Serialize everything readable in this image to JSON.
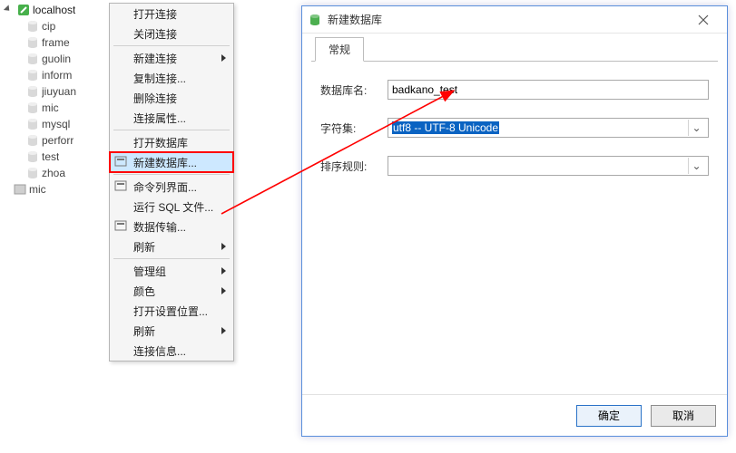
{
  "tree": {
    "root": "localhost",
    "children": [
      "cip",
      "frame",
      "guolin",
      "inform",
      "jiuyuan",
      "mic",
      "mysql",
      "perforr",
      "test",
      "zhoa"
    ],
    "other": "mic"
  },
  "contextmenu": {
    "header": "打开连接",
    "groups": [
      [
        "关闭连接"
      ],
      [
        "新建连接",
        "复制连接...",
        "删除连接",
        "连接属性..."
      ],
      [
        "打开数据库",
        "新建数据库..."
      ],
      [
        "命令列界面...",
        "运行 SQL 文件...",
        "数据传输...",
        "刷新"
      ],
      [
        "管理组",
        "颜色",
        "打开设置位置...",
        "刷新",
        "连接信息..."
      ]
    ],
    "arrows": [
      "新建连接",
      "刷新",
      "管理组",
      "颜色"
    ],
    "highlight": "新建数据库..."
  },
  "dialog": {
    "title": "新建数据库",
    "tab": "常规",
    "labels": {
      "name": "数据库名:",
      "charset": "字符集:",
      "collation": "排序规则:"
    },
    "values": {
      "name": "badkano_test",
      "charset": "utf8 -- UTF-8 Unicode",
      "collation": ""
    },
    "buttons": {
      "ok": "确定",
      "cancel": "取消"
    }
  }
}
